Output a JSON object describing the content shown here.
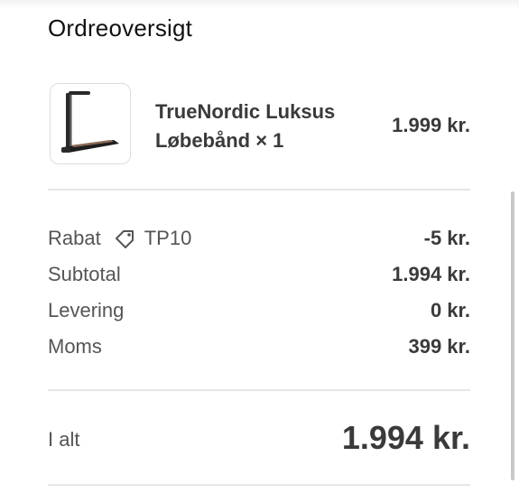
{
  "header": {
    "title": "Ordreoversigt"
  },
  "product": {
    "name": "TrueNordic Luksus Løbebånd × 1",
    "price": "1.999 kr.",
    "image_icon": "treadmill-product-image"
  },
  "summary": {
    "rows": [
      {
        "label": "Rabat",
        "code": "TP10",
        "icon": "tag-icon",
        "value": "-5 kr."
      },
      {
        "label": "Subtotal",
        "value": "1.994 kr."
      },
      {
        "label": "Levering",
        "value": "0 kr."
      },
      {
        "label": "Moms",
        "value": "399 kr."
      }
    ]
  },
  "total": {
    "label": "I alt",
    "value": "1.994 kr."
  }
}
